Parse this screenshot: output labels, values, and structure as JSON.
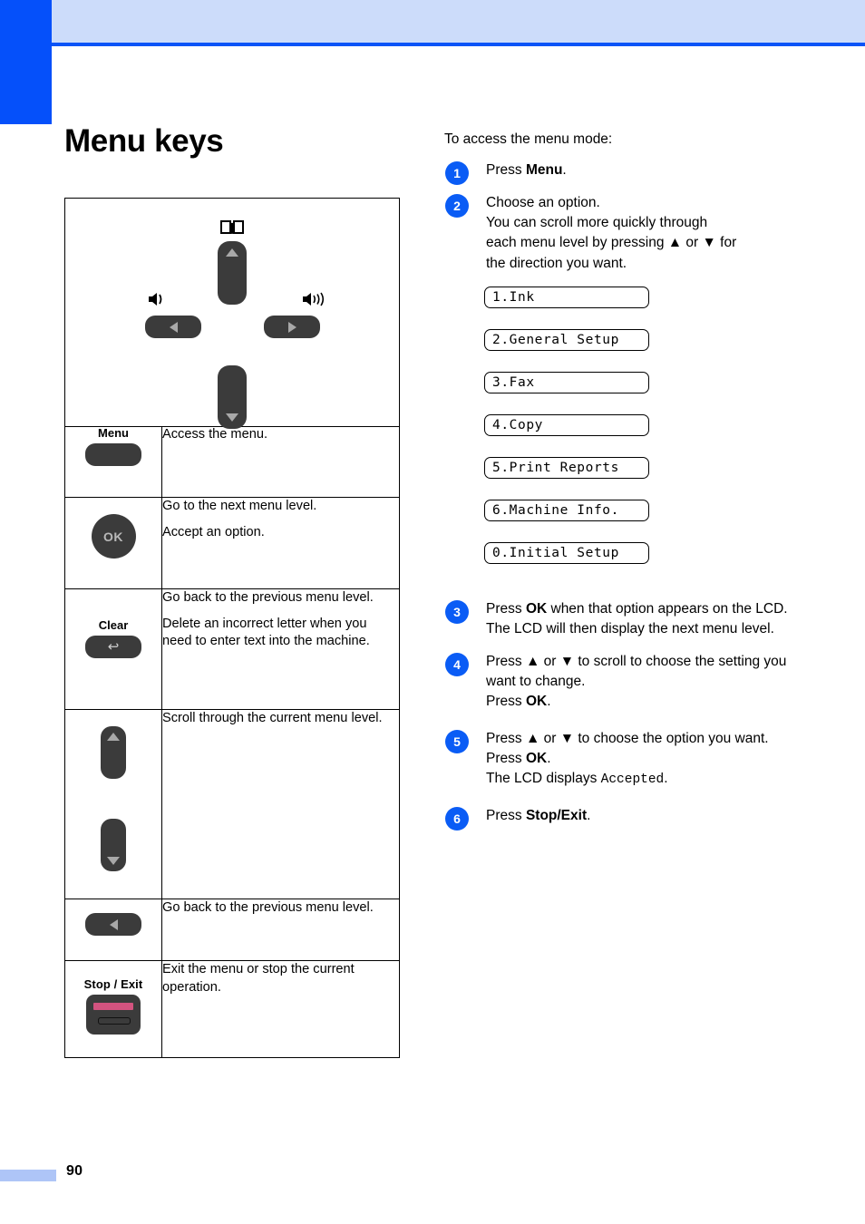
{
  "page": {
    "number": "90",
    "accent_blue": "#0550fa",
    "header_band": "#ccdcfa",
    "title": "Menu keys"
  },
  "control_panel_diagram": {
    "book_icon": "open-book-icon",
    "up_key": "scroll-up-key",
    "down_key": "scroll-down-key",
    "left_key": "volume-down-key",
    "right_key": "volume-up-key",
    "left_speaker_icon": "speaker-low-icon",
    "right_speaker_icon": "speaker-high-icon"
  },
  "key_table": {
    "rows": [
      {
        "key_label": "Menu",
        "key_glyph": "menu-pill-button",
        "descriptions": [
          "Access the menu."
        ]
      },
      {
        "key_label": "OK",
        "key_glyph": "ok-round-button",
        "descriptions": [
          "Go to the next menu level.",
          "Accept an option."
        ]
      },
      {
        "key_label": "Clear",
        "key_glyph": "clear-pill-button",
        "descriptions": [
          "Go back to the previous menu level.",
          "Delete an incorrect letter when you need to enter text into the machine."
        ]
      },
      {
        "key_label": "",
        "key_glyph": "up-down-arrow-keys",
        "descriptions": [
          "Scroll through the current menu level."
        ]
      },
      {
        "key_label": "",
        "key_glyph": "left-arrow-key",
        "descriptions": [
          "Go back to the previous menu level."
        ]
      },
      {
        "key_label": "Stop / Exit",
        "key_glyph": "stop-exit-button",
        "descriptions": [
          "Exit the menu or stop the current operation."
        ]
      }
    ]
  },
  "procedure": {
    "intro": "To access the menu mode:",
    "steps": [
      {
        "num": "1",
        "lines": [
          {
            "text": "Press "
          },
          {
            "text": "Menu",
            "bold": true
          },
          {
            "text": "."
          }
        ]
      },
      {
        "num": "2",
        "plain": "Choose an option.\nYou can scroll more quickly through each menu level by pressing ▲ or ▼ for the direction you want."
      },
      {
        "num": "3",
        "plain": "Press OK when that option appears on the LCD.\nThe LCD will then display the next menu level."
      },
      {
        "num": "4",
        "plain": "Press ▲ or ▼ to scroll to choose the setting you want to change.\nPress OK."
      },
      {
        "num": "5",
        "plain": "Press ▲ or ▼ to choose the option you want.\nPress OK.\nThe LCD displays Accepted."
      },
      {
        "num": "6",
        "plain": "Press Stop/Exit."
      }
    ],
    "step1_pre": "Press ",
    "step1_bold": "Menu",
    "step1_post": ".",
    "step2_l1": "Choose an option.",
    "step2_l2": "You can scroll more quickly through",
    "step2_l3a": "each menu level by pressing ",
    "step2_l3b": " or ",
    "step2_l3c": " for",
    "step2_l4": "the direction you want.",
    "step3_pre": "Press ",
    "step3_bold": "OK",
    "step3_post": " when that option appears on the LCD.",
    "step3_l2": "The LCD will then display the next menu level.",
    "step4_pre": "Press ",
    "step4_up": "▲",
    "step4_mid": " or ",
    "step4_down": "▼",
    "step4_post": " to scroll to choose the setting you want to change.",
    "step4_l2pre": "Press ",
    "step4_l2bold": "OK",
    "step4_l2post": ".",
    "step5_post": " to choose the option you want.",
    "step5_l2pre": "Press ",
    "step5_l2bold": "OK",
    "step5_l2post": ".",
    "step5_l3pre": "The LCD displays ",
    "step5_l3mono": "Accepted",
    "step5_l3post": ".",
    "step6_pre": "Press ",
    "step6_bold": "Stop/Exit",
    "step6_post": "."
  },
  "lcd_menu_items": [
    "1.Ink",
    "2.General Setup",
    "3.Fax",
    "4.Copy",
    "5.Print Reports",
    "6.Machine Info.",
    "0.Initial Setup"
  ]
}
